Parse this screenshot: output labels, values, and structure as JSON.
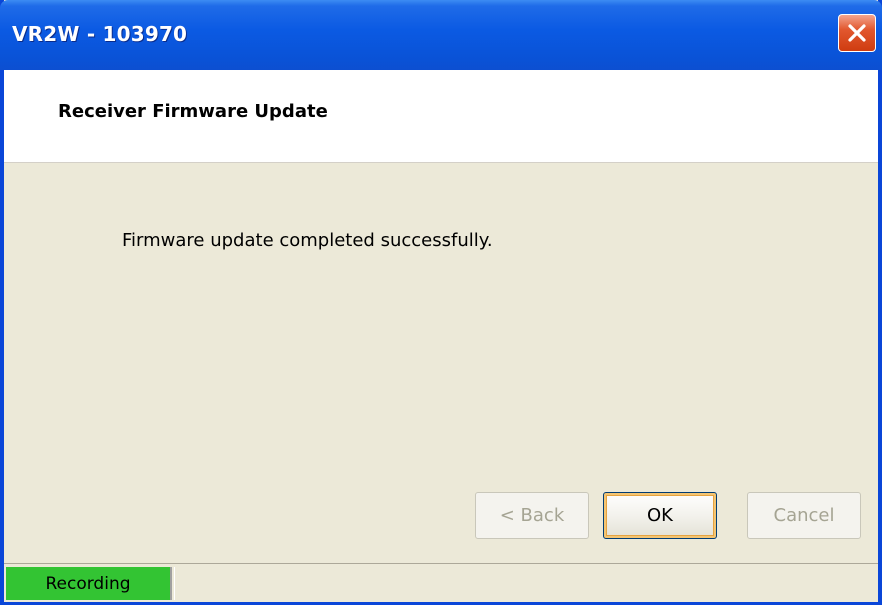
{
  "window": {
    "title": "VR2W - 103970",
    "close_icon": "close-icon",
    "title_color": "#0b5ae3",
    "close_color": "#e2582f"
  },
  "header": {
    "title": "Receiver Firmware Update"
  },
  "body": {
    "message": "Firmware update completed successfully."
  },
  "buttons": {
    "back_label": "< Back",
    "ok_label": "OK",
    "cancel_label": "Cancel",
    "back_enabled": false,
    "ok_enabled": true,
    "cancel_enabled": false
  },
  "statusbar": {
    "recording_label": "Recording",
    "recording_color": "#33c433"
  }
}
